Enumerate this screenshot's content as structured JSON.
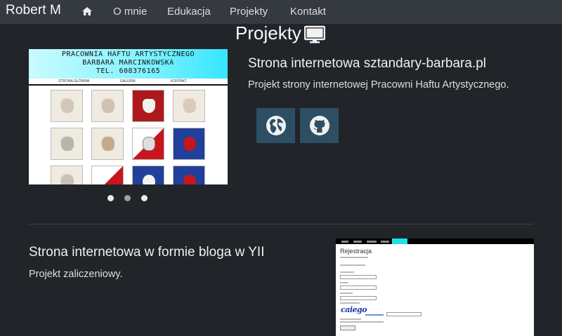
{
  "navbar": {
    "brand": "Robert M",
    "home_icon": "home-icon",
    "links": [
      "O mnie",
      "Edukacja",
      "Projekty",
      "Kontakt"
    ]
  },
  "section": {
    "title": "Projekty",
    "icon": "monitor-icon"
  },
  "projects": [
    {
      "title": "Strona internetowa sztandary-barbara.pl",
      "description": "Projekt strony internetowej Pracowni Haftu Artystycznego.",
      "buttons": [
        {
          "icon": "globe-icon"
        },
        {
          "icon": "github-icon"
        }
      ],
      "screenshot": {
        "header_lines": [
          "PRACOWNIA HAFTU ARTYSTYCZNEGO",
          "BARBARA MARCINKOWSKA",
          "TEL. 608376165"
        ],
        "menu": [
          "STRONA GŁÓWNA",
          "GALERIA",
          "KONTAKT"
        ]
      },
      "carousel_active_index": 0,
      "carousel_count": 3
    },
    {
      "title": "Strona internetowa w formie bloga w YII",
      "description": "Projekt zaliczeniowy.",
      "screenshot": {
        "heading": "Rejestracja",
        "captcha": "caiego"
      }
    }
  ],
  "colors": {
    "background": "#212529",
    "navbar": "#343a40",
    "icon_button": "#2e4f63"
  }
}
